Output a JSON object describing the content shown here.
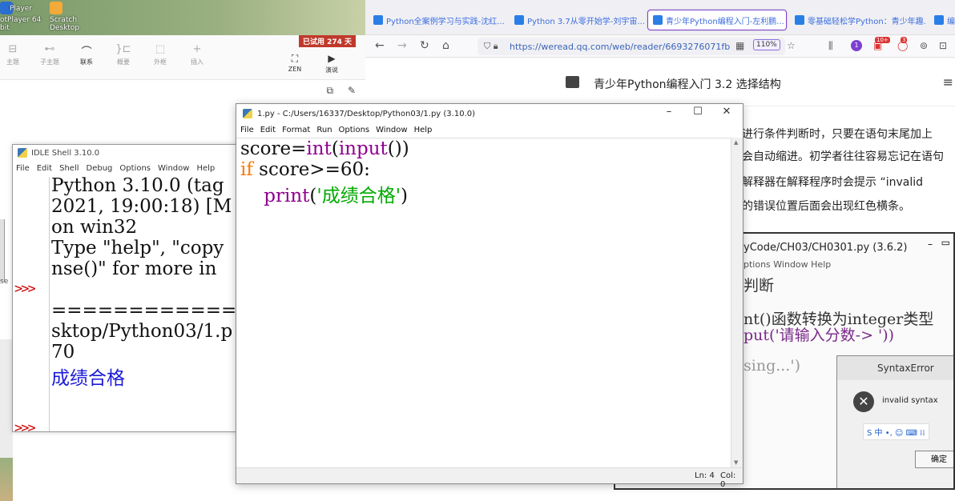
{
  "desktop": {
    "icons": [
      {
        "label_top": "Player",
        "label": "otPlayer 64",
        "label2": "bit"
      },
      {
        "label": "Scratch",
        "label2": "Desktop"
      }
    ]
  },
  "mindmap": {
    "trial_badge": "已试用 274 天",
    "tools": [
      {
        "label": "主题",
        "glyph": "⊟"
      },
      {
        "label": "子主题",
        "glyph": "⊷"
      },
      {
        "label": "联系",
        "glyph": "⌒"
      },
      {
        "label": "概要",
        "glyph": "}⊏"
      },
      {
        "label": "外框",
        "glyph": "⬚"
      },
      {
        "label": "插入",
        "glyph": "+"
      }
    ],
    "right_tools": [
      {
        "label": "ZEN",
        "glyph": "⛶"
      },
      {
        "label": "演说",
        "glyph": "▶"
      }
    ],
    "side_text": "se"
  },
  "browser": {
    "tabs": [
      {
        "title": "Python全案例学习与实践-沈红..."
      },
      {
        "title": "Python 3.7从零开始学-刘宇宙..."
      },
      {
        "title": "青少年Python编程入门-左利鹏..."
      },
      {
        "title": "零基础轻松学Python：青少年趣..."
      },
      {
        "title": "编"
      }
    ],
    "url": "https://weread.qq.com/web/reader/6693276071fb",
    "zoom": "110%",
    "notif_badge": "1",
    "badge_10": "10+",
    "badge_3": "3",
    "reader": {
      "chapter_title": "青少年Python编程入门 3.2 选择结构",
      "lines": [
        "进行条件判断时，只要在语句末尾加上",
        "会自动缩进。初学者往往容易忘记在语句",
        "解释器在解释程序时会提示 “invalid",
        "的错误位置后面会出现红色横条。"
      ],
      "embedded": {
        "title": "yCode/CH03/CH0301.py (3.6.2)",
        "menu": "ptions   Window   Help",
        "code_lines": [
          "判断",
          "nt()函数转换为integer类型",
          "put('请输入分数-> '))",
          "sing...')"
        ],
        "dialog_title": "SyntaxError",
        "error_text": "invalid syntax",
        "ok_label": "确定",
        "ime": "S 中 •, ☺ ⌨ ⁞⁞"
      }
    }
  },
  "shell": {
    "title": "IDLE Shell 3.10.0",
    "menu": [
      "File",
      "Edit",
      "Shell",
      "Debug",
      "Options",
      "Window",
      "Help"
    ],
    "prompts": [
      ">>>",
      ">>>"
    ],
    "lines": [
      "Python 3.10.0 (tag",
      "2021, 19:00:18) [M",
      "on win32",
      "Type \"help\", \"copy",
      "nse()\" for more in",
      "",
      "=================",
      "sktop/Python03/1.p",
      "70",
      "成绩合格"
    ]
  },
  "editor": {
    "title": "1.py - C:/Users/16337/Desktop/Python03/1.py (3.10.0)",
    "menu": [
      "File",
      "Edit",
      "Format",
      "Run",
      "Options",
      "Window",
      "Help"
    ],
    "code": {
      "l1_a": "score=",
      "l1_b": "int",
      "l1_c": "(",
      "l1_d": "input",
      "l1_e": "())",
      "l2_a": "if",
      "l2_b": " score>=60:",
      "l3_a": "    ",
      "l3_b": "print",
      "l3_c": "(",
      "l3_d": "'成绩合格'",
      "l3_e": ")"
    },
    "status": {
      "ln": "Ln: 4",
      "col": "Col: 0"
    }
  }
}
